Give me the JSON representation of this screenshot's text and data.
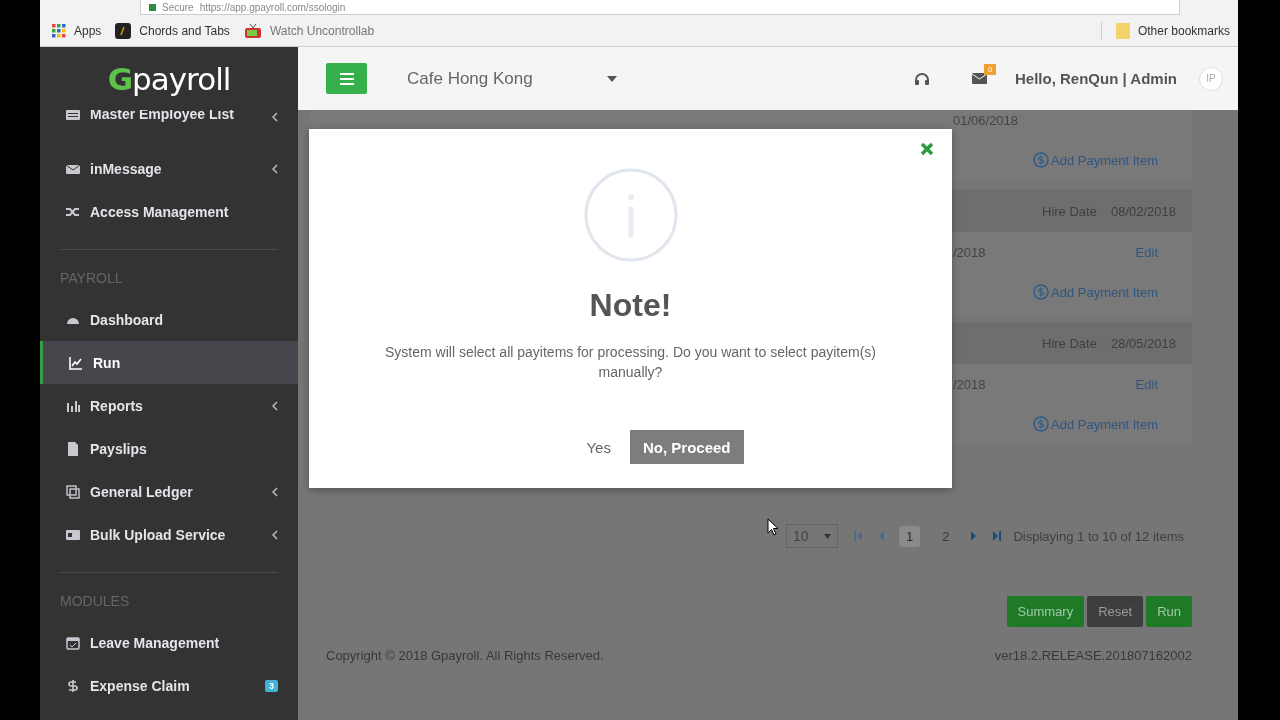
{
  "browser": {
    "secure_label": "Secure",
    "url": "https://app.gpayroll.com/ssologin",
    "bookmarks": [
      {
        "label": "Apps"
      },
      {
        "label": "Chords and Tabs"
      },
      {
        "label": "Watch Uncontrollab"
      }
    ],
    "other_bookmarks": "Other bookmarks"
  },
  "header": {
    "logo_initial": "G",
    "logo_rest": "payroll",
    "company": "Cafe Hong Kong",
    "mail_count": "0",
    "greeting": "Hello, RenQun | Admin",
    "avatar": "IP"
  },
  "sidebar": {
    "sections": [
      {
        "items": [
          {
            "label": "Master Employee List",
            "expandable": true,
            "selected": false
          },
          {
            "label": "inMessage",
            "expandable": true,
            "selected": false
          },
          {
            "label": "Access Management",
            "expandable": false,
            "selected": false
          }
        ]
      },
      {
        "title": "PAYROLL",
        "items": [
          {
            "label": "Dashboard",
            "expandable": false,
            "selected": false
          },
          {
            "label": "Run",
            "expandable": false,
            "selected": true
          },
          {
            "label": "Reports",
            "expandable": true,
            "selected": false
          },
          {
            "label": "Payslips",
            "expandable": false,
            "selected": false
          },
          {
            "label": "General Ledger",
            "expandable": true,
            "selected": false
          },
          {
            "label": "Bulk Upload Service",
            "expandable": true,
            "selected": false
          }
        ]
      },
      {
        "title": "MODULES",
        "items": [
          {
            "label": "Leave Management",
            "expandable": false,
            "selected": false
          },
          {
            "label": "Expense Claim",
            "expandable": false,
            "selected": false,
            "badge": "3"
          }
        ]
      }
    ]
  },
  "records": [
    {
      "date": "01/06/2018",
      "add_payment": "Add Payment Item"
    },
    {
      "hire_label": "Hire Date",
      "hire_date": "08/02/2018",
      "date": "/2018",
      "edit": "Edit",
      "add_payment": "Add Payment Item"
    },
    {
      "hire_label": "Hire Date",
      "hire_date": "28/05/2018",
      "date": "/2018",
      "edit": "Edit",
      "add_payment": "Add Payment Item"
    }
  ],
  "pagination": {
    "page_size": "10",
    "pages": [
      {
        "label": "1",
        "selected": true
      },
      {
        "label": "2",
        "selected": false
      }
    ],
    "summary": "Displaying 1 to 10 of 12 items"
  },
  "actions": [
    {
      "label": "Summary",
      "kind": "primary"
    },
    {
      "label": "Reset",
      "kind": "secondary"
    },
    {
      "label": "Run",
      "kind": "primary"
    }
  ],
  "footer": {
    "copyright": "Copyright © 2018 Gpayroll. All Rights Reserved.",
    "version": "ver18.2.RELEASE.201807162002"
  },
  "modal": {
    "title": "Note!",
    "message": "System will select all payitems for processing. Do you want to select payitem(s) manually?",
    "buttons": [
      {
        "label": "Yes",
        "kind": "plain"
      },
      {
        "label": "No, Proceed",
        "kind": "default"
      }
    ]
  }
}
